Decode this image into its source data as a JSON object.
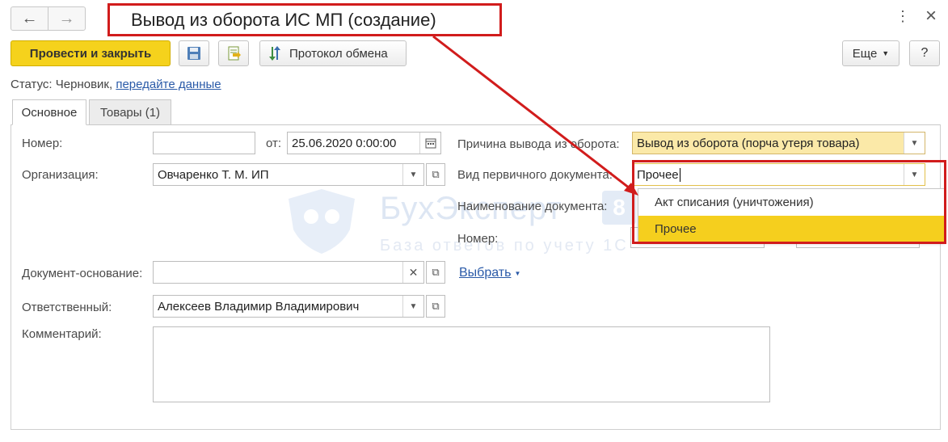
{
  "header": {
    "back_icon": "←",
    "forward_icon": "→",
    "title": "Вывод из оборота ИС МП (создание)",
    "menu_icon": "⋮",
    "close_icon": "×"
  },
  "toolbar": {
    "post_close_label": "Провести и закрыть",
    "protocol_label": "Протокол обмена",
    "more_label": "Еще",
    "help_label": "?"
  },
  "status": {
    "label": "Статус:",
    "value": "Черновик,",
    "link": "передайте данные"
  },
  "tabs": [
    {
      "label": "Основное"
    },
    {
      "label": "Товары (1)"
    }
  ],
  "form": {
    "number_label": "Номер:",
    "number_value": "",
    "date_label": "от:",
    "date_value": "25.06.2020  0:00:00",
    "organization_label": "Организация:",
    "organization_value": "Овчаренко Т. М. ИП",
    "base_doc_label": "Документ-основание:",
    "base_doc_value": "",
    "choose_link": "Выбрать",
    "responsible_label": "Ответственный:",
    "responsible_value": "Алексеев Владимир Владимирович",
    "comment_label": "Комментарий:",
    "comment_value": "",
    "reason_label": "Причина вывода из оборота:",
    "reason_value": "Вывод из оборота (порча утеря товара)",
    "primary_doc_label": "Вид первичного документа:",
    "primary_doc_value": "Прочее",
    "doc_name_label": "Наименование документа:",
    "doc_number_label": "Номер:"
  },
  "dropdown": {
    "options": [
      "Акт списания (уничтожения)",
      "Прочее"
    ],
    "selected": "Прочее"
  },
  "watermark": {
    "brand": "БухЭксперт",
    "badge": "8",
    "tagline": "База ответов по учету 1С"
  },
  "colors": {
    "accent_yellow": "#f5d21c",
    "annotation_red": "#d11c1c",
    "link_blue": "#2a5aa8"
  }
}
